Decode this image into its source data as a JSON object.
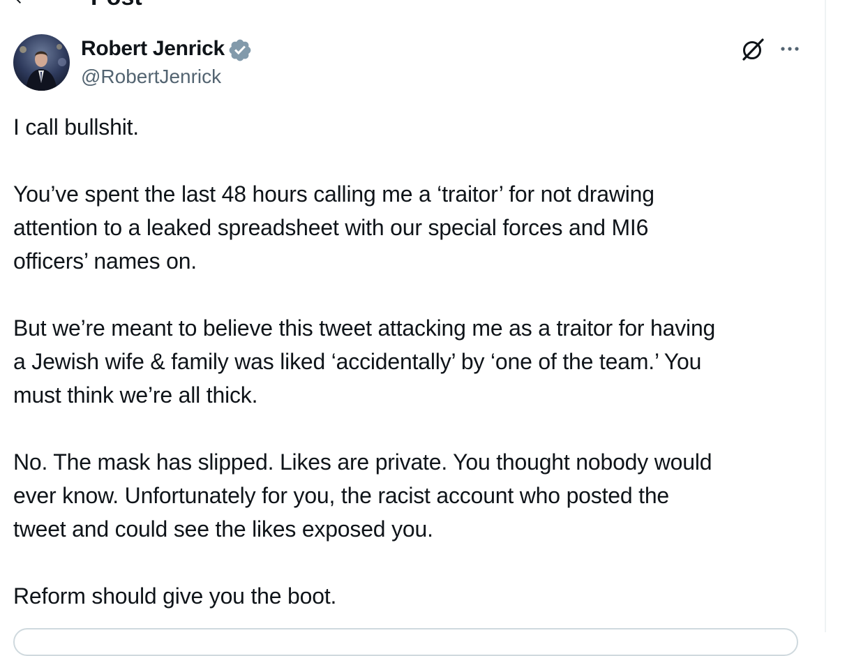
{
  "header": {
    "title": "Post",
    "back_icon": "arrow-left-icon"
  },
  "author": {
    "name": "Robert Jenrick",
    "handle": "@RobertJenrick",
    "verified_icon": "verified-badge-icon",
    "verified_color": "#829aab"
  },
  "actions": {
    "grok_icon": "grok-icon",
    "more_icon": "more-horizontal-icon"
  },
  "post": {
    "paragraphs": [
      {
        "lines": [
          "I call bullshit."
        ]
      },
      {
        "lines": [
          "You’ve spent the last 48 hours calling me a ‘traitor’ for not drawing",
          "attention to a leaked spreadsheet with our special forces and MI6",
          "officers’ names on."
        ]
      },
      {
        "lines": [
          "But we’re meant to believe this tweet attacking me as a traitor for having",
          "a Jewish wife & family was liked ‘accidentally’ by ‘one of the team.’ You",
          "must think we’re all thick."
        ]
      },
      {
        "lines": [
          "No. The mask has slipped. Likes are private. You thought nobody would",
          "ever know. Unfortunately for you, the racist account who posted the",
          "tweet and could see the likes exposed you."
        ]
      },
      {
        "lines": [
          "Reform should give you the boot."
        ]
      }
    ]
  },
  "colors": {
    "text": "#0f1419",
    "secondary_text": "#536471",
    "border": "#cfd9de"
  }
}
